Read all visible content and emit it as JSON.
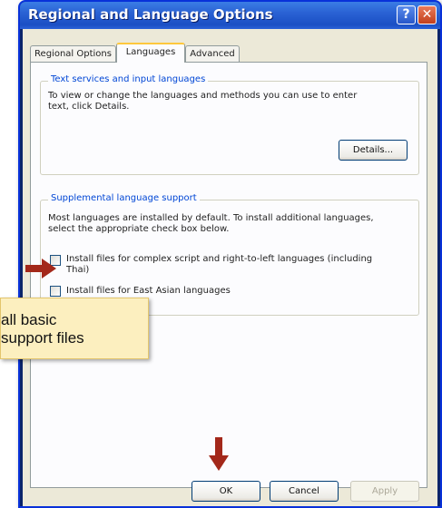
{
  "window": {
    "title": "Regional and Language Options",
    "help_glyph": "?",
    "close_glyph": "✕"
  },
  "tabs": [
    {
      "label": "Regional Options",
      "selected": false
    },
    {
      "label": "Languages",
      "selected": true
    },
    {
      "label": "Advanced",
      "selected": false
    }
  ],
  "text_services": {
    "title": "Text services and input languages",
    "description_line1": "To view or change the languages and methods you can use to enter",
    "description_line2": "text, click Details.",
    "details_button": "Details..."
  },
  "supplemental": {
    "title": "Supplemental language support",
    "description_line1": "Most languages are installed by default. To install additional languages,",
    "description_line2": "select the appropriate check box below.",
    "complex_script_line1": "Install files for complex script and right-to-left languages (including",
    "complex_script_line2": "Thai)",
    "complex_script_checked": false,
    "east_asian_label": "Install files for East Asian languages",
    "east_asian_checked": false
  },
  "footer": {
    "ok": "OK",
    "cancel": "Cancel",
    "apply": "Apply"
  },
  "callout": {
    "line1": "all basic",
    "line2": "support files"
  },
  "colors": {
    "arrow": "#a3281a",
    "callout_bg": "#fcefbf",
    "group_title": "#0046d5",
    "selected_tab_accent": "#ffc83c"
  }
}
